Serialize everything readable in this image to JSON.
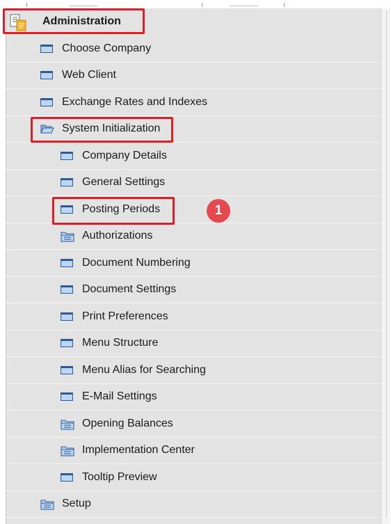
{
  "menu": {
    "header": {
      "label": "Administration",
      "icon": "document-module-icon"
    },
    "items": [
      {
        "label": "Choose Company",
        "icon": "window-icon"
      },
      {
        "label": "Web Client",
        "icon": "window-icon"
      },
      {
        "label": "Exchange Rates and Indexes",
        "icon": "window-icon"
      },
      {
        "label": "System Initialization",
        "icon": "open-folder-icon",
        "expanded": true
      },
      {
        "label": "Company Details",
        "icon": "window-icon"
      },
      {
        "label": "General Settings",
        "icon": "window-icon"
      },
      {
        "label": "Posting Periods",
        "icon": "window-icon"
      },
      {
        "label": "Authorizations",
        "icon": "folder-icon"
      },
      {
        "label": "Document Numbering",
        "icon": "window-icon"
      },
      {
        "label": "Document Settings",
        "icon": "window-icon"
      },
      {
        "label": "Print Preferences",
        "icon": "window-icon"
      },
      {
        "label": "Menu Structure",
        "icon": "window-icon"
      },
      {
        "label": "Menu Alias for Searching",
        "icon": "window-icon"
      },
      {
        "label": "E-Mail Settings",
        "icon": "window-icon"
      },
      {
        "label": "Opening Balances",
        "icon": "folder-icon"
      },
      {
        "label": "Implementation Center",
        "icon": "folder-icon"
      },
      {
        "label": "Tooltip Preview",
        "icon": "window-icon"
      },
      {
        "label": "Setup",
        "icon": "folder-icon"
      }
    ]
  },
  "annotation": {
    "step_badge": "1"
  },
  "colors": {
    "highlight": "#e31b23",
    "badge": "#e5484d",
    "tree_background": "#e3e3e3"
  }
}
